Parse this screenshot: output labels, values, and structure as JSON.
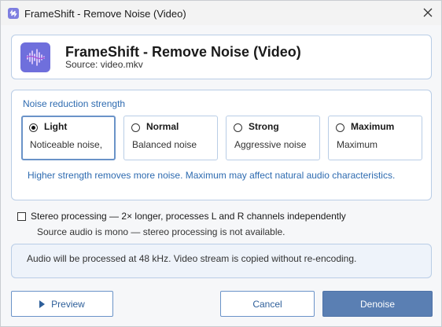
{
  "window": {
    "title": "FrameShift - Remove Noise (Video)"
  },
  "header": {
    "title": "FrameShift - Remove Noise (Video)",
    "source": "Source: video.mkv",
    "icon": "waveform-icon"
  },
  "strength": {
    "group_label": "Noise reduction strength",
    "options": [
      {
        "name": "Light",
        "desc": "Noticeable noise,",
        "selected": true
      },
      {
        "name": "Normal",
        "desc": "Balanced noise",
        "selected": false
      },
      {
        "name": "Strong",
        "desc": "Aggressive noise",
        "selected": false
      },
      {
        "name": "Maximum",
        "desc": "Maximum",
        "selected": false
      }
    ],
    "hint": "Higher strength removes more noise. Maximum may affect natural audio characteristics."
  },
  "stereo": {
    "label": "Stereo processing  —  2× longer, processes L and R channels independently",
    "checked": false,
    "note": "Source audio is mono — stereo processing is not available."
  },
  "info": {
    "text": "Audio will be processed at 48 kHz. Video stream is copied without re-encoding."
  },
  "buttons": {
    "preview": "Preview",
    "cancel": "Cancel",
    "denoise": "Denoise"
  },
  "colors": {
    "accent": "#5a7fb3",
    "link_text": "#2e6bb0",
    "card_border": "#b9cde6",
    "icon_purple": "#6f6fdc"
  }
}
